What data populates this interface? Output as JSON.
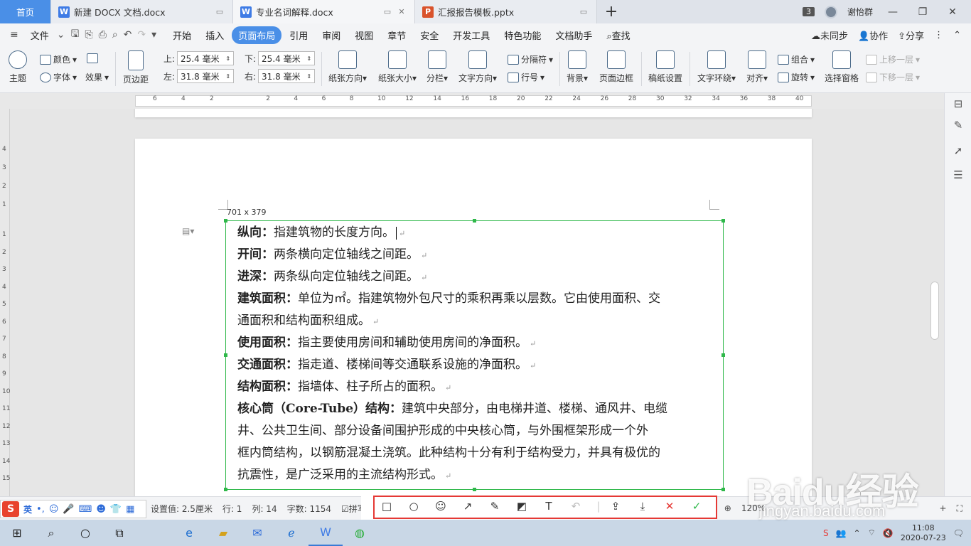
{
  "tabs": {
    "home": "首页",
    "docs": [
      {
        "name": "新建 DOCX 文档.docx",
        "type": "W",
        "active": false
      },
      {
        "name": "专业名词解释.docx",
        "type": "W",
        "active": true
      },
      {
        "name": "汇报报告模板.pptx",
        "type": "P",
        "active": false
      }
    ],
    "new_tab": "+",
    "window_count": "3",
    "user": "谢怡群"
  },
  "menu": {
    "file": "文件",
    "items": [
      "开始",
      "插入",
      "页面布局",
      "引用",
      "审阅",
      "视图",
      "章节",
      "安全",
      "开发工具",
      "特色功能",
      "文档助手"
    ],
    "active": "页面布局",
    "search": "查找",
    "sync": "未同步",
    "collab": "协作",
    "share": "分享"
  },
  "ribbon": {
    "theme": "主题",
    "color": "颜色",
    "font": "字体",
    "effect": "效果",
    "margins": "页边距",
    "top_label": "上:",
    "bottom_label": "下:",
    "left_label": "左:",
    "right_label": "右:",
    "top_val": "25.4 毫米",
    "bottom_val": "25.4 毫米",
    "left_val": "31.8 毫米",
    "right_val": "31.8 毫米",
    "orientation": "纸张方向",
    "size": "纸张大小",
    "columns": "分栏",
    "text_dir": "文字方向",
    "breaks": "分隔符",
    "line_num": "行号",
    "background": "背景",
    "page_border": "页面边框",
    "manuscript": "稿纸设置",
    "wrap": "文字环绕",
    "align": "对齐",
    "group": "组合",
    "rotate": "旋转",
    "selection_pane": "选择窗格",
    "bring_forward": "上移一层",
    "send_backward": "下移一层"
  },
  "ruler": {
    "ticks": [
      "6",
      "4",
      "2",
      "2",
      "4",
      "6",
      "8",
      "10",
      "12",
      "14",
      "16",
      "18",
      "20",
      "22",
      "24",
      "26",
      "28",
      "30",
      "32",
      "34",
      "36",
      "38",
      "40"
    ]
  },
  "vruler": {
    "ticks": [
      "4",
      "3",
      "2",
      "1",
      "1",
      "2",
      "3",
      "4",
      "5",
      "6",
      "7",
      "8",
      "9",
      "10",
      "11",
      "12",
      "13",
      "14",
      "15"
    ]
  },
  "selection": {
    "dimensions": "701 x 379"
  },
  "document": {
    "lines": [
      {
        "term": "纵向：",
        "text": "指建筑物的长度方向。"
      },
      {
        "term": "开间：",
        "text": "两条横向定位轴线之间距。"
      },
      {
        "term": "进深：",
        "text": "两条纵向定位轴线之间距。"
      },
      {
        "term": "建筑面积：",
        "text": "单位为㎡。指建筑物外包尺寸的乘积再乘以层数。它由使用面积、交"
      },
      {
        "term": "",
        "text": "通面积和结构面积组成。"
      },
      {
        "term": "使用面积：",
        "text": "指主要使用房间和辅助使用房间的净面积。"
      },
      {
        "term": "交通面积：",
        "text": "指走道、楼梯间等交通联系设施的净面积。"
      },
      {
        "term": "结构面积：",
        "text": "指墙体、柱子所占的面积。"
      },
      {
        "term": "核心筒（Core-Tube）结构：",
        "text": "建筑中央部分，由电梯井道、楼梯、通风井、电缆"
      },
      {
        "term": "",
        "text": "井、公共卫生间、部分设备间围护形成的中央核心筒，与外围框架形成一个外"
      },
      {
        "term": "",
        "text": "框内筒结构，以钢筋混凝土浇筑。此种结构十分有利于结构受力，并具有极优的"
      },
      {
        "term": "",
        "text": "抗震性，是广泛采用的主流结构形式。"
      }
    ]
  },
  "status": {
    "setting": "设置值: 2.5厘米",
    "row": "行: 1",
    "col": "列: 14",
    "wordcount": "字数: 1154",
    "spellcheck": "拼写检查",
    "zoom": "120%"
  },
  "ime": {
    "lang": "英"
  },
  "taskbar": {
    "time": "11:08",
    "date": "2020-07-23"
  },
  "watermark": {
    "brand": "Baidu经验",
    "url": "jingyan.baidu.com"
  }
}
